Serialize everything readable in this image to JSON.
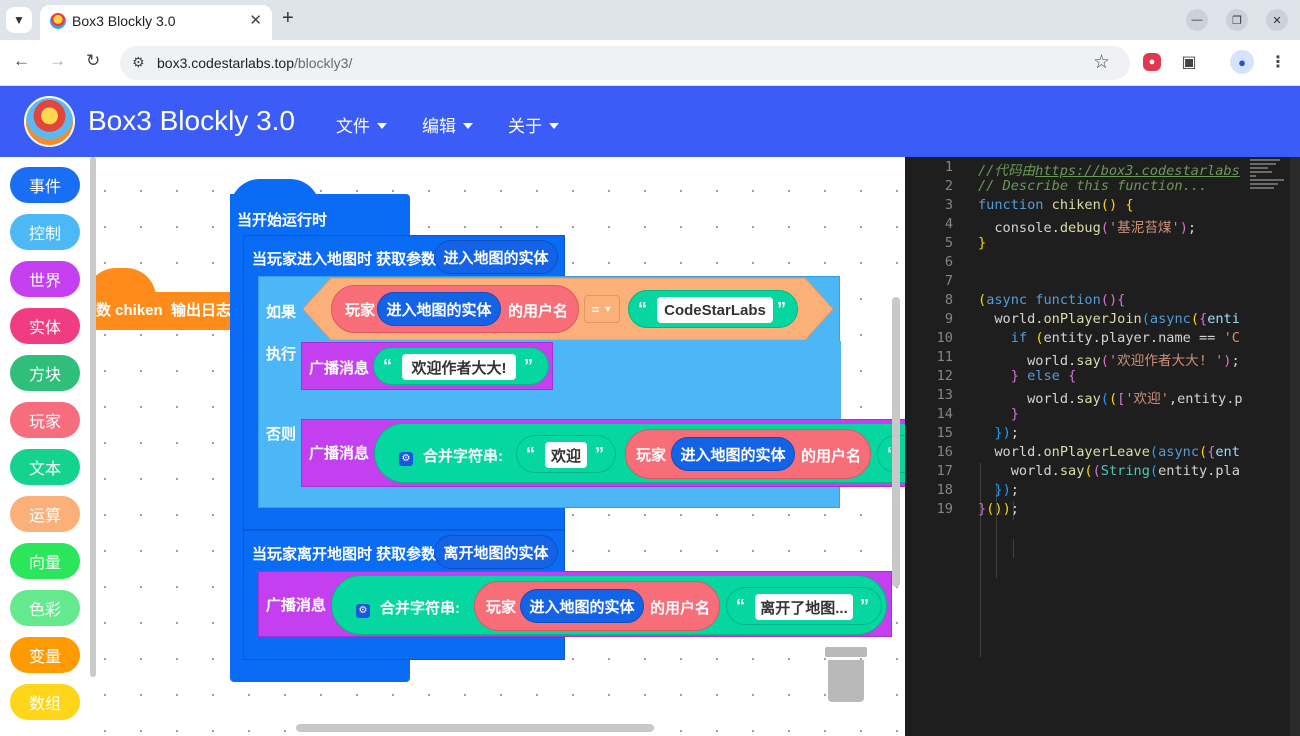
{
  "browser": {
    "tab_title": "Box3 Blockly 3.0",
    "url_host": "box3.codestarlabs.top",
    "url_path": "/blockly3/"
  },
  "app": {
    "title": "Box3 Blockly 3.0",
    "menus": [
      "文件",
      "编辑",
      "关于"
    ]
  },
  "toolbox": {
    "categories": [
      {
        "label": "事件",
        "color": "#1a6ef5"
      },
      {
        "label": "控制",
        "color": "#4cb8f5"
      },
      {
        "label": "世界",
        "color": "#c43ff0"
      },
      {
        "label": "实体",
        "color": "#f03c82"
      },
      {
        "label": "方块",
        "color": "#2fbf7a"
      },
      {
        "label": "玩家",
        "color": "#f66e7d"
      },
      {
        "label": "文本",
        "color": "#14d38f"
      },
      {
        "label": "运算",
        "color": "#fbb07a"
      },
      {
        "label": "向量",
        "color": "#2be55a"
      },
      {
        "label": "色彩",
        "color": "#65e98e"
      },
      {
        "label": "变量",
        "color": "#ff9a00"
      },
      {
        "label": "数组",
        "color": "#ffd51a"
      }
    ]
  },
  "blocks": {
    "func_label": "数 chiken",
    "func_action": "输出日志",
    "start_hat": "当开始运行时",
    "join_event": "当玩家进入地图时 获取参数",
    "join_param": "进入地图的实体",
    "if_label": "如果",
    "then_label": "执行",
    "else_label": "否则",
    "player_label": "玩家",
    "entity_ref": "进入地图的实体",
    "username_label": "的用户名",
    "compare_op": "=",
    "compare_value": "CodeStarLabs",
    "broadcast_label": "广播消息",
    "welcome_author": "欢迎作者大大!",
    "join_strings": "合并字符串:",
    "welcome": "欢迎",
    "leave_event": "当玩家离开地图时 获取参数",
    "leave_param": "离开地图的实体",
    "left_map": "离开了地图..."
  },
  "code": {
    "line_numbers": [
      "1",
      "2",
      "3",
      "4",
      "5",
      "6",
      "7",
      "8",
      "9",
      "10",
      "11",
      "12",
      "13",
      "14",
      "15",
      "16",
      "17",
      "18",
      "19"
    ],
    "line1_prefix": "//代码由",
    "line1_url": "https://box3.codestarlabs",
    "line2": "// Describe this function...",
    "func_name": "chiken",
    "debug_text": "'基泥苔煤'",
    "name_check": "'C",
    "say_author": "'欢迎作者大大! '",
    "say_welcome": "'欢迎'"
  }
}
